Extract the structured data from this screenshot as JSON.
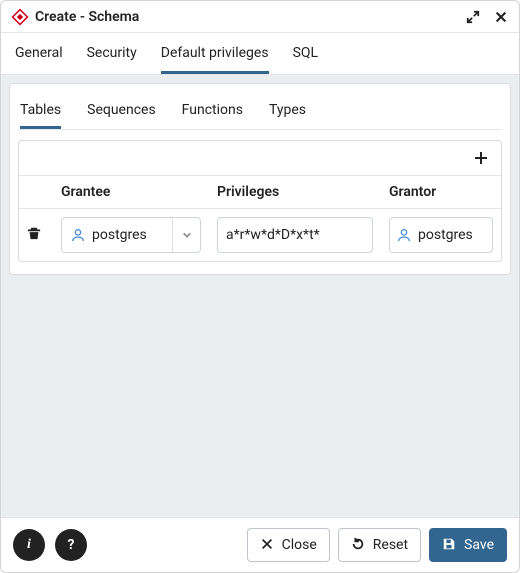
{
  "title": "Create - Schema",
  "top_tabs": {
    "general": "General",
    "security": "Security",
    "default_privileges": "Default privileges",
    "sql": "SQL",
    "active": "default_privileges"
  },
  "sub_tabs": {
    "tables": "Tables",
    "sequences": "Sequences",
    "functions": "Functions",
    "types": "Types",
    "active": "tables"
  },
  "grid": {
    "headers": {
      "grantee": "Grantee",
      "privileges": "Privileges",
      "grantor": "Grantor"
    },
    "rows": [
      {
        "grantee": "postgres",
        "privileges": "a*r*w*d*D*x*t*",
        "grantor": "postgres"
      }
    ]
  },
  "footer": {
    "info": "i",
    "help": "?",
    "close": "Close",
    "reset": "Reset",
    "save": "Save"
  }
}
